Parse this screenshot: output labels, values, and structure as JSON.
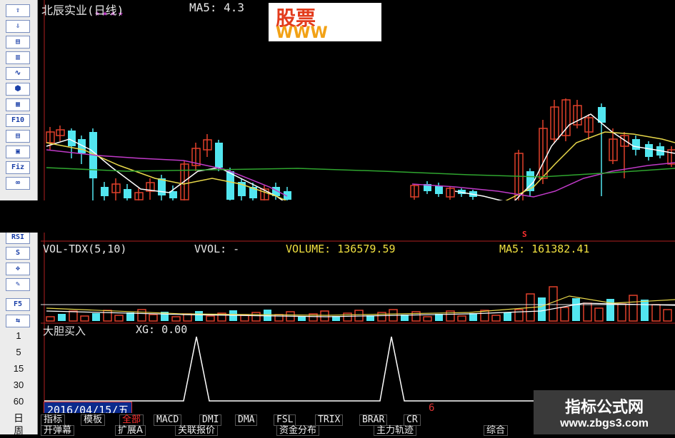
{
  "toolbar": {
    "buttons": [
      "⇧",
      "⇩",
      "▤",
      "▥",
      "∿",
      "⬢",
      "▦",
      "F10",
      "▤",
      "▣",
      "Fiz",
      "∞",
      "RSI",
      "S",
      "✥",
      "✎",
      "F5",
      "⇆"
    ],
    "scale_labels": [
      "1",
      "5",
      "15",
      "30",
      "60"
    ],
    "bottom_labels": [
      "日",
      "周"
    ]
  },
  "header": {
    "title": "北辰实业(日线)",
    "ma_label": "MA5: 4.3",
    "logo_big": "股票",
    "logo_www": "WWW"
  },
  "volume_panel": {
    "indicator": "VOL-TDX(5,10)",
    "vvol": "VVOL: -",
    "volume": "VOLUME: 136579.59",
    "ma5": "MA5: 161382.41",
    "marker": "S"
  },
  "xg_panel": {
    "name": "大胆买入",
    "xg": "XG: 0.00"
  },
  "status": {
    "date": "2016/04/15/五",
    "month_marker": "6"
  },
  "tabs_row1": [
    "指标",
    "模板",
    "全部",
    "MACD",
    "DMI",
    "DMA",
    "FSL",
    "TRIX",
    "BRAR",
    "CR"
  ],
  "tabs_row2": [
    "开弹幕",
    "扩展A",
    "关联报价",
    "资金分布",
    "主力轨迹",
    "综合"
  ],
  "watermark": {
    "line1": "指标公式网",
    "line2": "www.zbgs3.com"
  },
  "colors": {
    "up": "#e0402a",
    "down": "#52e6f0",
    "ma_white": "#ffffff",
    "ma_yellow": "#e8d84a",
    "ma_purple": "#c03ac8",
    "ma_green": "#2fa52f",
    "text_yellow": "#f0e040"
  },
  "chart_data": {
    "type": "candlestick",
    "candles_top_region": "daily price chart with MA lines",
    "xg_signal_peaks": 2
  }
}
